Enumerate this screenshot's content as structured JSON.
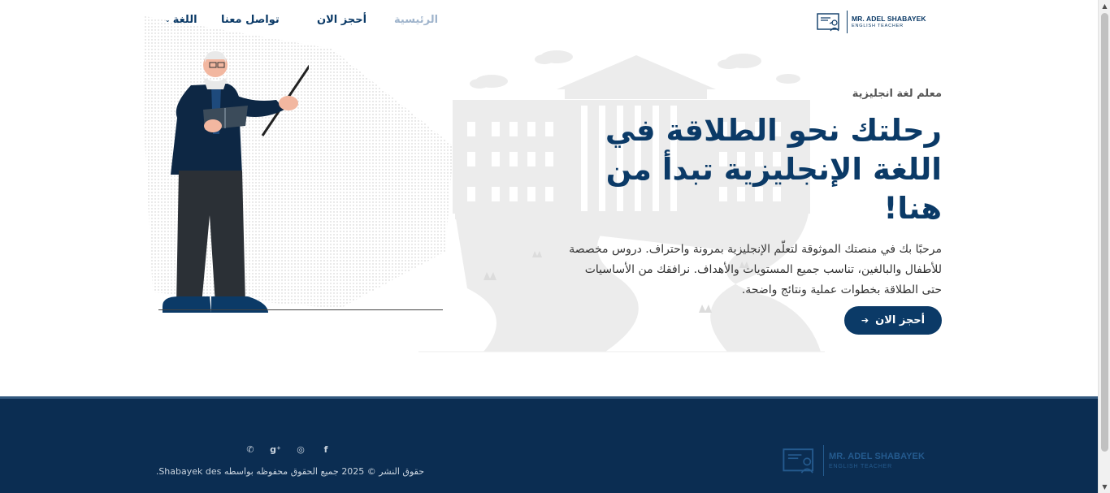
{
  "brand": {
    "name": "MR. ADEL SHABAYEK",
    "subtitle": "ENGLISH TEACHER"
  },
  "nav": {
    "home": "الرئيسية",
    "book": "أحجز الان",
    "contact": "تواصل معنا",
    "language": "اللغة"
  },
  "hero": {
    "subtitle": "معلم لغة انجليزية",
    "title_line1": "رحلتك نحو الطلاقة في",
    "title_line2": "اللغة الإنجليزية تبدأ من هنا!",
    "description": "مرحبًا بك في منصتك الموثوقة لتعلّم الإنجليزية بمرونة واحتراف. دروس مخصصة للأطفال والبالغين، تناسب جميع المستويات والأهداف. نرافقك من الأساسيات حتى الطلاقة بخطوات عملية ونتائج واضحة.",
    "cta_label": "أحجز الان",
    "cta_icon": "arrow-left-icon"
  },
  "footer": {
    "copyright": "حقوق النشر © 2025 جميع الحقوق محفوظه بواسطه Shabayek des.",
    "socials": [
      "facebook-icon",
      "instagram-icon",
      "google-plus-icon",
      "whatsapp-icon"
    ]
  },
  "colors": {
    "primary": "#0b3a67",
    "nav_active": "#9fb4cc",
    "footer_bg": "#0b2d52"
  }
}
